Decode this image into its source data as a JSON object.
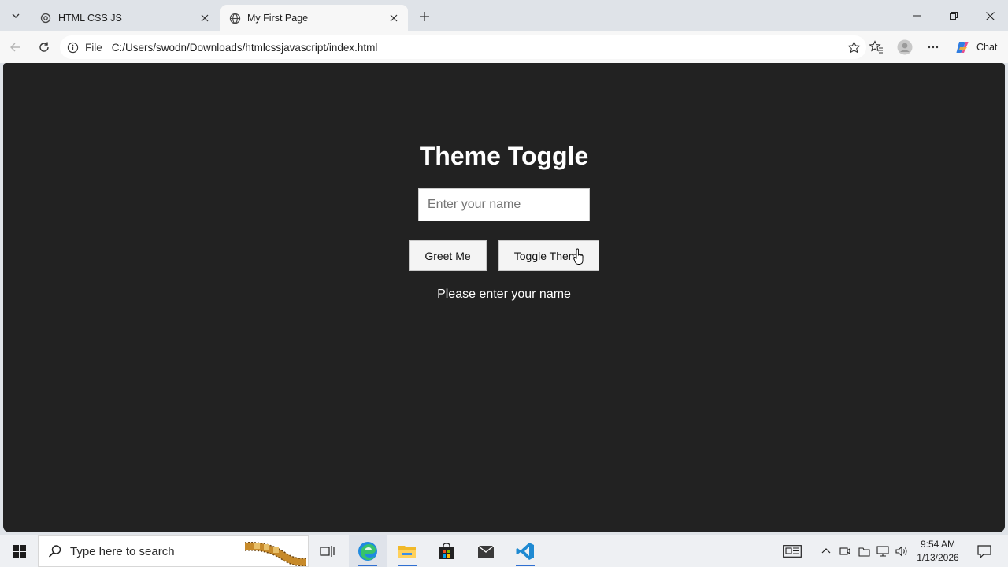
{
  "browser": {
    "tabs": [
      {
        "title": "HTML CSS JS",
        "icon": "openai-icon",
        "active": false
      },
      {
        "title": "My First Page",
        "icon": "globe-icon",
        "active": true
      }
    ],
    "address": {
      "scheme_label": "File",
      "url": "C:/Users/swodn/Downloads/htmlcssjavascript/index.html"
    },
    "chat_label": "Chat"
  },
  "page": {
    "title": "Theme Toggle",
    "name_input": {
      "placeholder": "Enter your name",
      "value": ""
    },
    "greet_button": "Greet Me",
    "toggle_button": "Toggle Theme",
    "message": "Please enter your name",
    "background": "#222222",
    "text_color": "#ffffff"
  },
  "taskbar": {
    "search_placeholder": "Type here to search",
    "apps": [
      "task-view-icon",
      "edge-icon",
      "file-explorer-icon",
      "store-icon",
      "mail-icon",
      "vscode-icon"
    ],
    "clock": {
      "time": "9:54 AM",
      "date": "1/13/2026"
    }
  }
}
